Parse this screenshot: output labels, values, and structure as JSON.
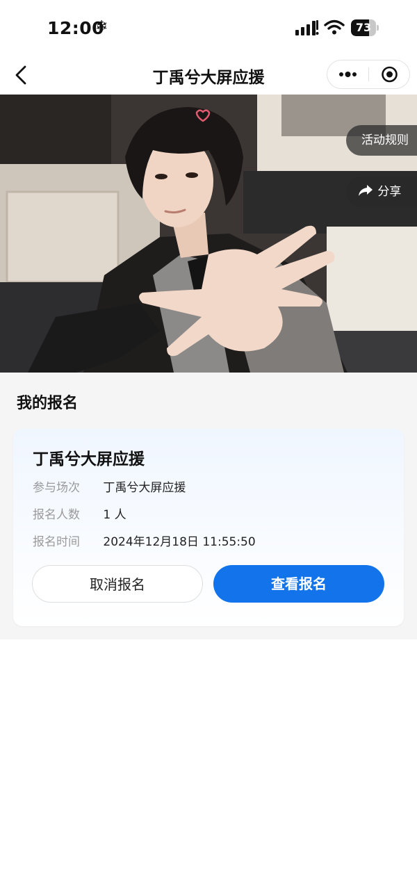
{
  "status_bar": {
    "time": "12:00",
    "weather_icon": "snowflake-icon",
    "battery": "73",
    "battery_level": 0.73
  },
  "nav": {
    "title": "丁禹兮大屏应援",
    "back_icon": "chevron-left-icon",
    "more_icon": "more-dots-icon",
    "close_icon": "target-circle-icon"
  },
  "banner": {
    "rules_label": "活动规则",
    "share_label": "分享",
    "share_icon": "share-arrow-icon"
  },
  "registration": {
    "section_title": "我的报名",
    "card_title": "丁禹兮大屏应援",
    "rows": [
      {
        "label": "参与场次",
        "value": "丁禹兮大屏应援"
      },
      {
        "label": "报名人数",
        "value": "1 人"
      },
      {
        "label": "报名时间",
        "value": "2024年12月18日 11:55:50"
      }
    ],
    "cancel_label": "取消报名",
    "view_label": "查看报名"
  },
  "colors": {
    "accent": "#1273ea",
    "page_bg": "#f5f5f5"
  }
}
